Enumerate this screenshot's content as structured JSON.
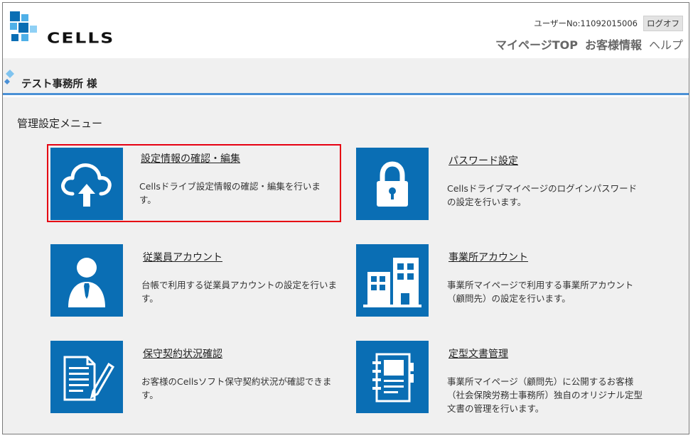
{
  "header": {
    "logo_text": "CELLS",
    "user_no": "ユーザーNo:11092015006",
    "logout_label": "ログオフ",
    "nav": [
      {
        "label": "マイページTOP"
      },
      {
        "label": "お客様情報"
      },
      {
        "label": "ヘルプ"
      }
    ]
  },
  "band": {
    "title": "テスト事務所 様"
  },
  "main": {
    "section_title": "管理設定メニュー",
    "cards": [
      {
        "title": "設定情報の確認・編集",
        "desc": "Cellsドライブ設定情報の確認・編集を行います。",
        "icon": "cloud-upload-icon"
      },
      {
        "title": "パスワード設定",
        "desc": "Cellsドライブマイページのログインパスワードの設定を行います。",
        "icon": "lock-icon"
      },
      {
        "title": "従業員アカウント",
        "desc": "台帳で利用する従業員アカウントの設定を行います。",
        "icon": "person-icon"
      },
      {
        "title": "事業所アカウント",
        "desc": "事業所マイページで利用する事業所アカウント（顧問先）の設定を行います。",
        "icon": "building-icon"
      },
      {
        "title": "保守契約状況確認",
        "desc": "お客様のCellsソフト保守契約状況が確認できます。",
        "icon": "document-pen-icon"
      },
      {
        "title": "定型文書管理",
        "desc": "事業所マイページ（顧問先）に公開するお客様（社会保険労務士事務所）独自のオリジナル定型文書の管理を行います。",
        "icon": "binder-icon"
      }
    ]
  },
  "colors": {
    "tile_blue": "#0a6eb4",
    "accent_blue": "#4a90d6",
    "highlight_red": "#e60012"
  }
}
